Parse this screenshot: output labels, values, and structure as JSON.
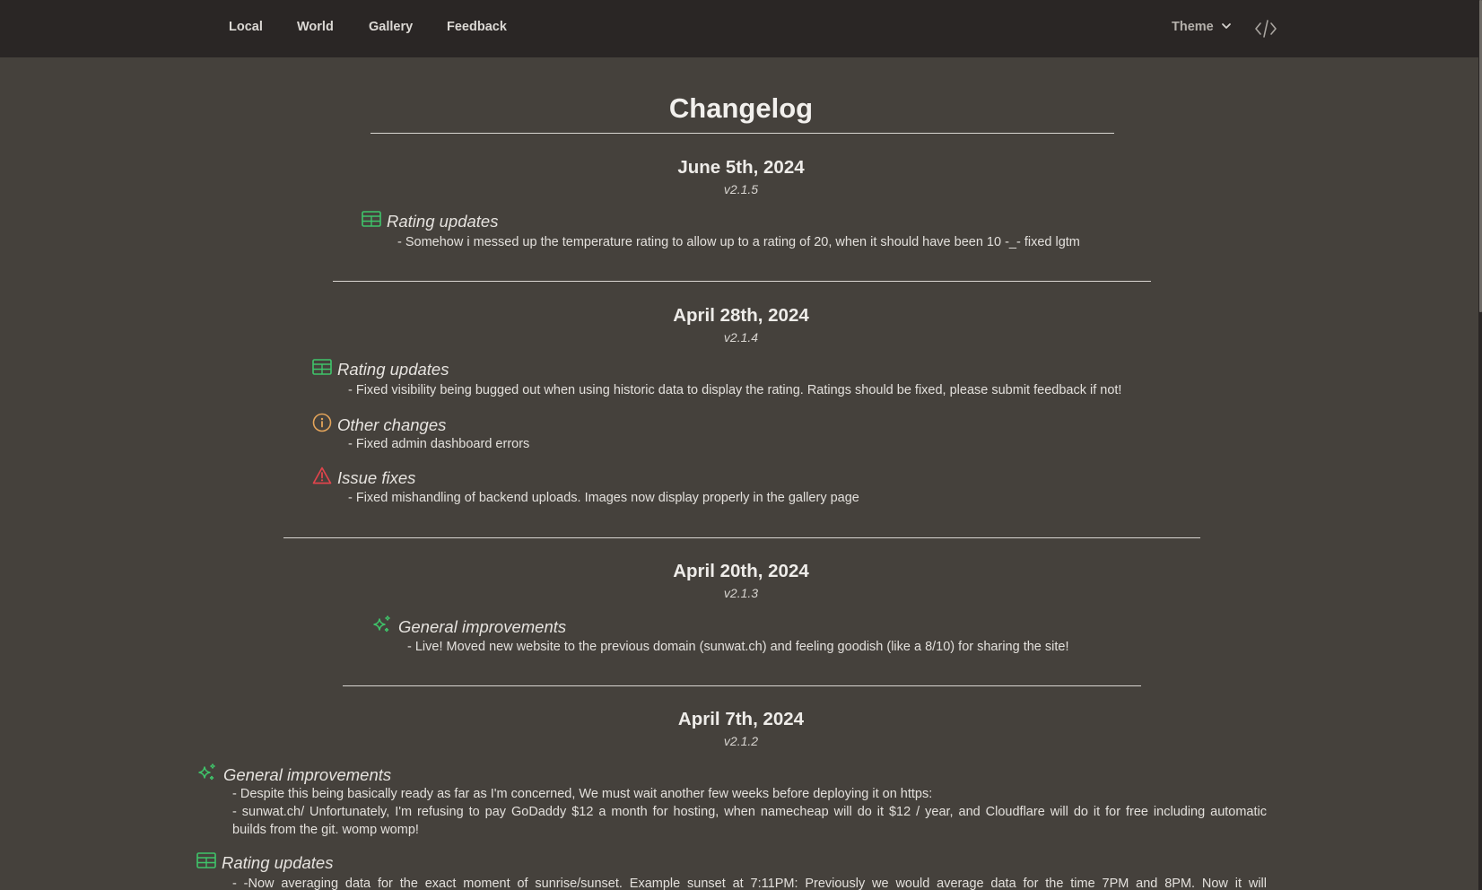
{
  "nav": {
    "links": [
      "Local",
      "World",
      "Gallery",
      "Feedback"
    ],
    "theme_label": "Theme",
    "theme_icon": "chevron-down-icon",
    "code_icon": "code-icon"
  },
  "page_title": "Changelog",
  "colors": {
    "rating_icon": "#3fc46a",
    "info_icon": "#e4a45a",
    "warning_icon": "#e0444c",
    "sparkle_icon": "#3fc46a"
  },
  "entries": [
    {
      "date": "June 5th, 2024",
      "version": "v2.1.5",
      "sections": [
        {
          "icon": "table-icon",
          "title": "Rating updates",
          "lines": [
            "- Somehow i messed up the temperature rating to allow up to a rating of 20, when it should have been 10 -_- fixed lgtm"
          ]
        }
      ]
    },
    {
      "date": "April 28th, 2024",
      "version": "v2.1.4",
      "sections": [
        {
          "icon": "table-icon",
          "title": "Rating updates",
          "lines": [
            "- Fixed visibility being bugged out when using historic data to display the rating. Ratings should be fixed, please submit feedback if not!"
          ]
        },
        {
          "icon": "info-icon",
          "title": "Other changes",
          "lines": [
            "- Fixed admin dashboard errors"
          ]
        },
        {
          "icon": "warning-icon",
          "title": "Issue fixes",
          "lines": [
            "- Fixed mishandling of backend uploads. Images now display properly in the gallery page"
          ]
        }
      ]
    },
    {
      "date": "April 20th, 2024",
      "version": "v2.1.3",
      "sections": [
        {
          "icon": "sparkles-icon",
          "title": "General improvements",
          "lines": [
            "- Live! Moved new website to the previous domain (sunwat.ch) and feeling goodish (like a 8/10) for sharing the site!"
          ]
        }
      ]
    },
    {
      "date": "April 7th, 2024",
      "version": "v2.1.2",
      "sections": [
        {
          "icon": "sparkles-icon",
          "title": "General improvements",
          "lines": [
            "- Despite this being basically ready as far as I'm concerned, We must wait another few weeks before deploying it on https:",
            "- sunwat.ch/ Unfortunately, I'm refusing to pay GoDaddy $12 a month for hosting, when namecheap will do it $12 / year, and Cloudflare will do it for free including automatic",
            "builds from the git. womp womp!"
          ]
        },
        {
          "icon": "table-icon",
          "title": "Rating updates",
          "lines": [
            "- -Now averaging data for the exact moment of sunrise/sunset. Example sunset at 7:11PM: Previously we would average data for the time 7PM and 8PM. Now it will"
          ]
        }
      ]
    }
  ]
}
